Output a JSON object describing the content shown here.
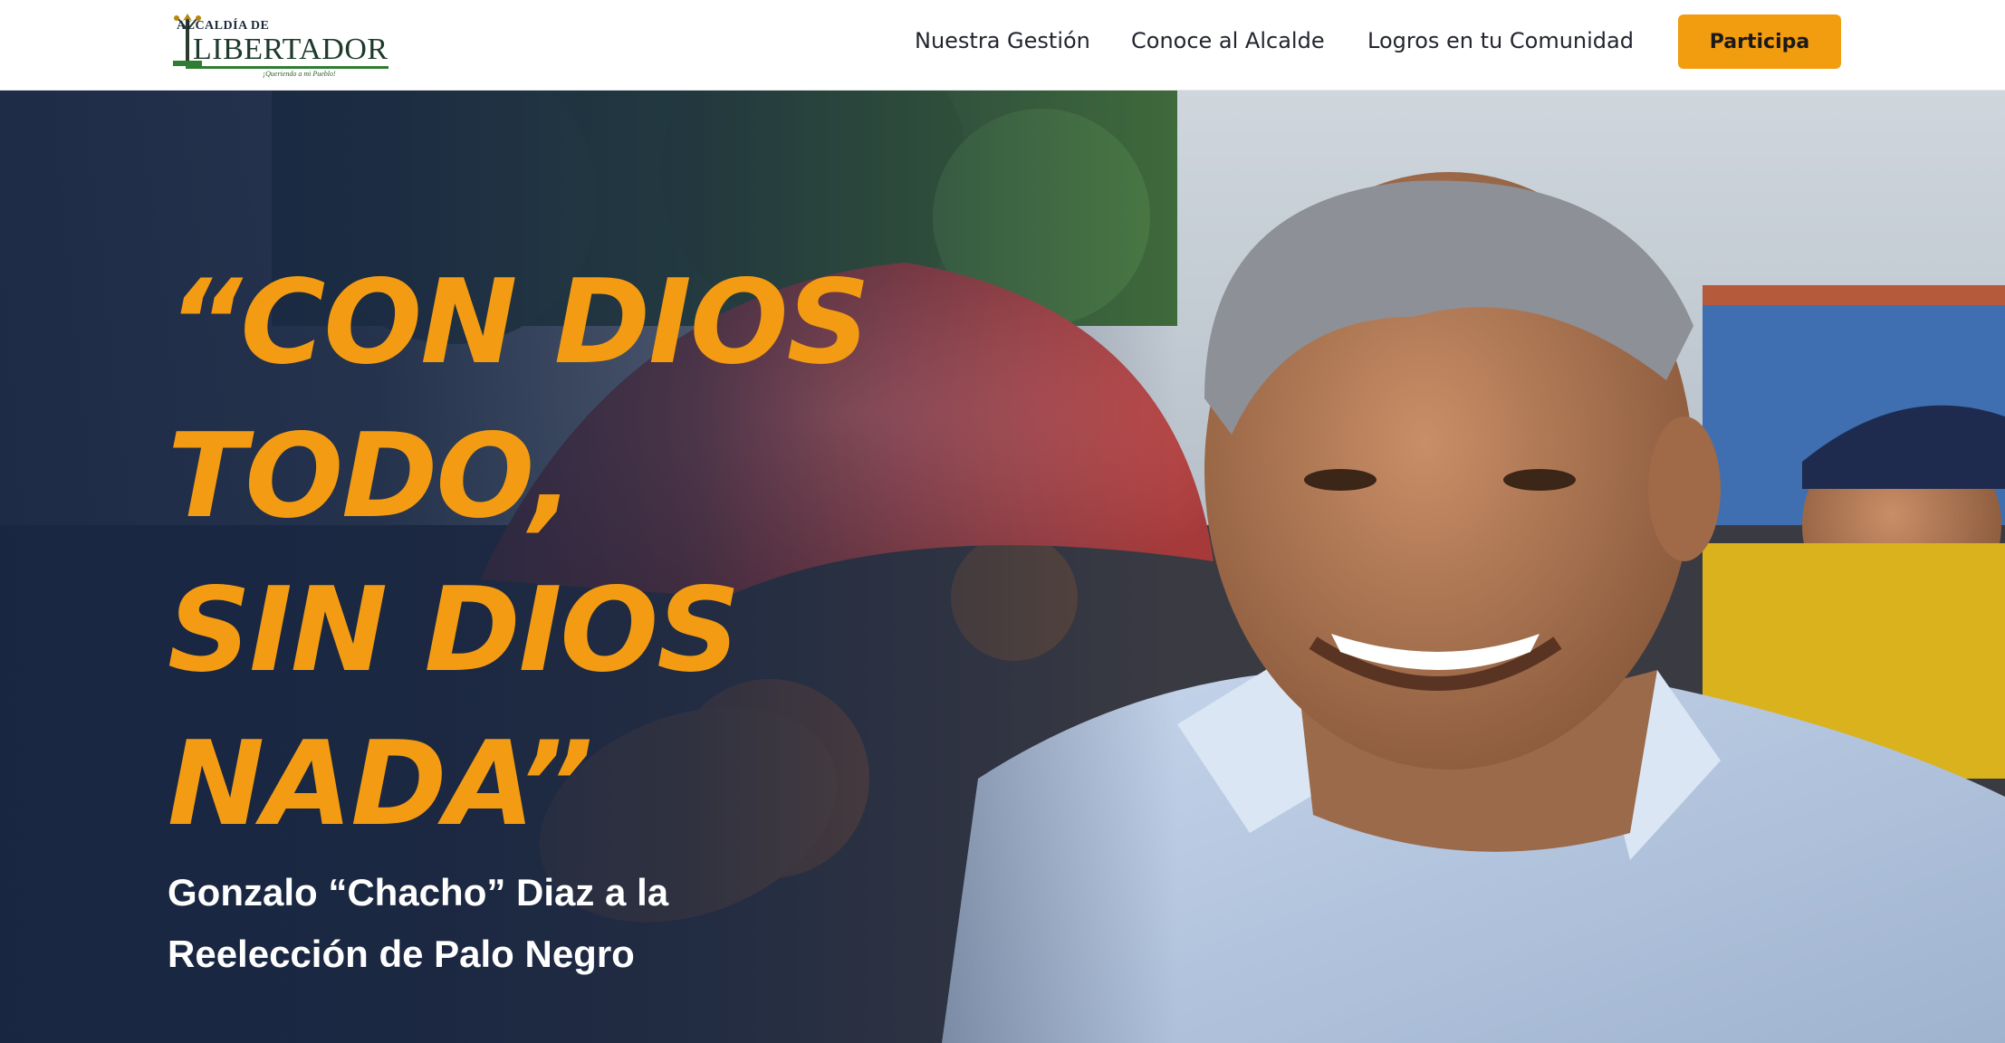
{
  "header": {
    "logo": {
      "line1": "ALCALDÍA DE",
      "line2": "LIBERTADOR",
      "slogan": "¡Queriendo a mi Pueblo!"
    },
    "nav": [
      {
        "label": "Nuestra Gestión"
      },
      {
        "label": "Conoce al Alcalde"
      },
      {
        "label": "Logros en tu Comunidad"
      }
    ],
    "cta_label": "Participa"
  },
  "hero": {
    "quote_lines": [
      "“CON DIOS",
      "TODO,",
      "SIN DIOS",
      "NADA”"
    ],
    "subtitle_lines": [
      "Gonzalo “Chacho” Diaz a la",
      "Reelección de Palo Negro"
    ]
  },
  "colors": {
    "accent": "#f29c0f",
    "hero_overlay": "#182642",
    "text_on_dark": "#ffffff"
  }
}
